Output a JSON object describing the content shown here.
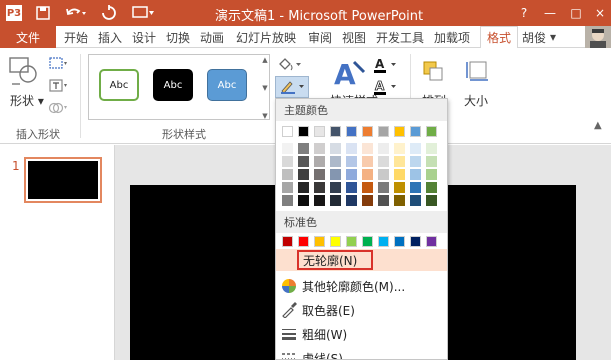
{
  "titlebar": {
    "title": "演示文稿1 - Microsoft PowerPoint",
    "app_badge": "P3",
    "window_buttons": [
      "?",
      "—",
      "□",
      "×"
    ]
  },
  "tabs": {
    "file": "文件",
    "items": [
      "开始",
      "插入",
      "设计",
      "切换",
      "动画",
      "幻灯片放映",
      "审阅",
      "视图",
      "开发工具",
      "加载项",
      "格式"
    ],
    "active": "格式",
    "user": "胡俊",
    "user_arrow": "▾"
  },
  "ribbon": {
    "shapes_label": "形状",
    "insert_shapes_group": "插入形状",
    "shape_styles_group": "形状样式",
    "style_tiles": [
      "Abc",
      "Abc",
      "Abc"
    ],
    "quick_styles_label": "快速样式",
    "arrange_label": "排列",
    "size_label": "大小",
    "text_a": "A"
  },
  "slides": {
    "number": "1"
  },
  "menu": {
    "theme_colors_label": "主题颜色",
    "standard_colors_label": "标准色",
    "no_outline": "无轮廓(N)",
    "more_colors": "其他轮廓颜色(M)...",
    "eyedropper": "取色器(E)",
    "weight": "粗细(W)",
    "dashes": "虚线(S)",
    "theme_top": [
      "#ffffff",
      "#000000",
      "#e7e6e6",
      "#44546a",
      "#4472c4",
      "#ed7d31",
      "#a5a5a5",
      "#ffc000",
      "#5b9bd5",
      "#70ad47"
    ],
    "theme_shades": [
      [
        "#f2f2f2",
        "#7f7f7f",
        "#d0cece",
        "#d6dce4",
        "#dae3f3",
        "#fbe5d6",
        "#ededed",
        "#fff2cc",
        "#deebf7",
        "#e2f0d9"
      ],
      [
        "#d9d9d9",
        "#595959",
        "#aeabab",
        "#adb9ca",
        "#b4c7e7",
        "#f8cbad",
        "#dbdbdb",
        "#ffe699",
        "#bdd7ee",
        "#c5e0b4"
      ],
      [
        "#bfbfbf",
        "#3f3f3f",
        "#757070",
        "#8496b0",
        "#8faadc",
        "#f4b183",
        "#c9c9c9",
        "#ffd966",
        "#9dc3e6",
        "#a9d18e"
      ],
      [
        "#a6a6a6",
        "#262626",
        "#3a3838",
        "#333f50",
        "#2f5597",
        "#c55a11",
        "#7b7b7b",
        "#bf9000",
        "#2e75b6",
        "#548235"
      ],
      [
        "#7f7f7f",
        "#0d0d0d",
        "#171616",
        "#222a35",
        "#1f3864",
        "#843c0c",
        "#525252",
        "#7f6000",
        "#1f4e79",
        "#385723"
      ]
    ],
    "standard": [
      "#c00000",
      "#ff0000",
      "#ffc000",
      "#ffff00",
      "#92d050",
      "#00b050",
      "#00b0f0",
      "#0070c0",
      "#002060",
      "#7030a0"
    ]
  }
}
